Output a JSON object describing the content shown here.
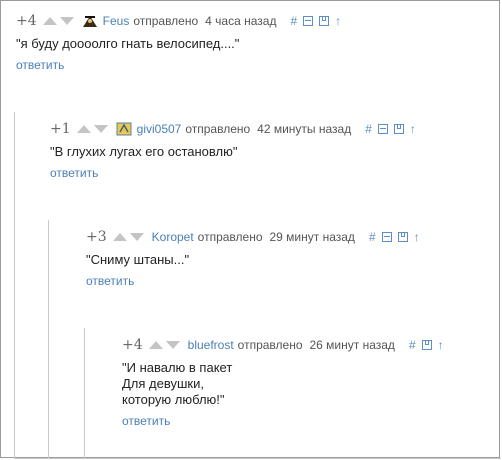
{
  "comments": [
    {
      "score": "+4",
      "user": "Feus",
      "sent": "отправлено",
      "time": "4 часа назад",
      "text": "\"я буду доооолго гнать велосипед....\"",
      "reply": "ответить",
      "avatar_icon": "pirate-avatar-icon",
      "tools": [
        "#",
        "collapse",
        "save",
        "↑"
      ]
    },
    {
      "score": "+1",
      "user": "givi0507",
      "sent": "отправлено",
      "time": "42 минуты назад",
      "text": "\"В глухих лугах его остановлю\"",
      "reply": "ответить",
      "avatar_icon": "badge-avatar-icon",
      "tools": [
        "#",
        "collapse",
        "save",
        "↑"
      ]
    },
    {
      "score": "+3",
      "user": "Koropet",
      "sent": "отправлено",
      "time": "29 минут назад",
      "text": "\"Сниму штаны...\"",
      "reply": "ответить",
      "tools": [
        "#",
        "collapse",
        "save",
        "↑"
      ]
    },
    {
      "score": "+4",
      "user": "bluefrost",
      "sent": "отправлено",
      "time": "26 минут назад",
      "text": "\"И навалю в пакет\nДля девушки,\nкоторую люблю!\"",
      "reply": "ответить",
      "tools": [
        "#",
        "save",
        "↑"
      ]
    }
  ],
  "colors": {
    "link": "#4a7fb5",
    "tool": "#5b8fc6",
    "arrow": "#c4c4c4",
    "thread_line": "#c9c9c9"
  }
}
